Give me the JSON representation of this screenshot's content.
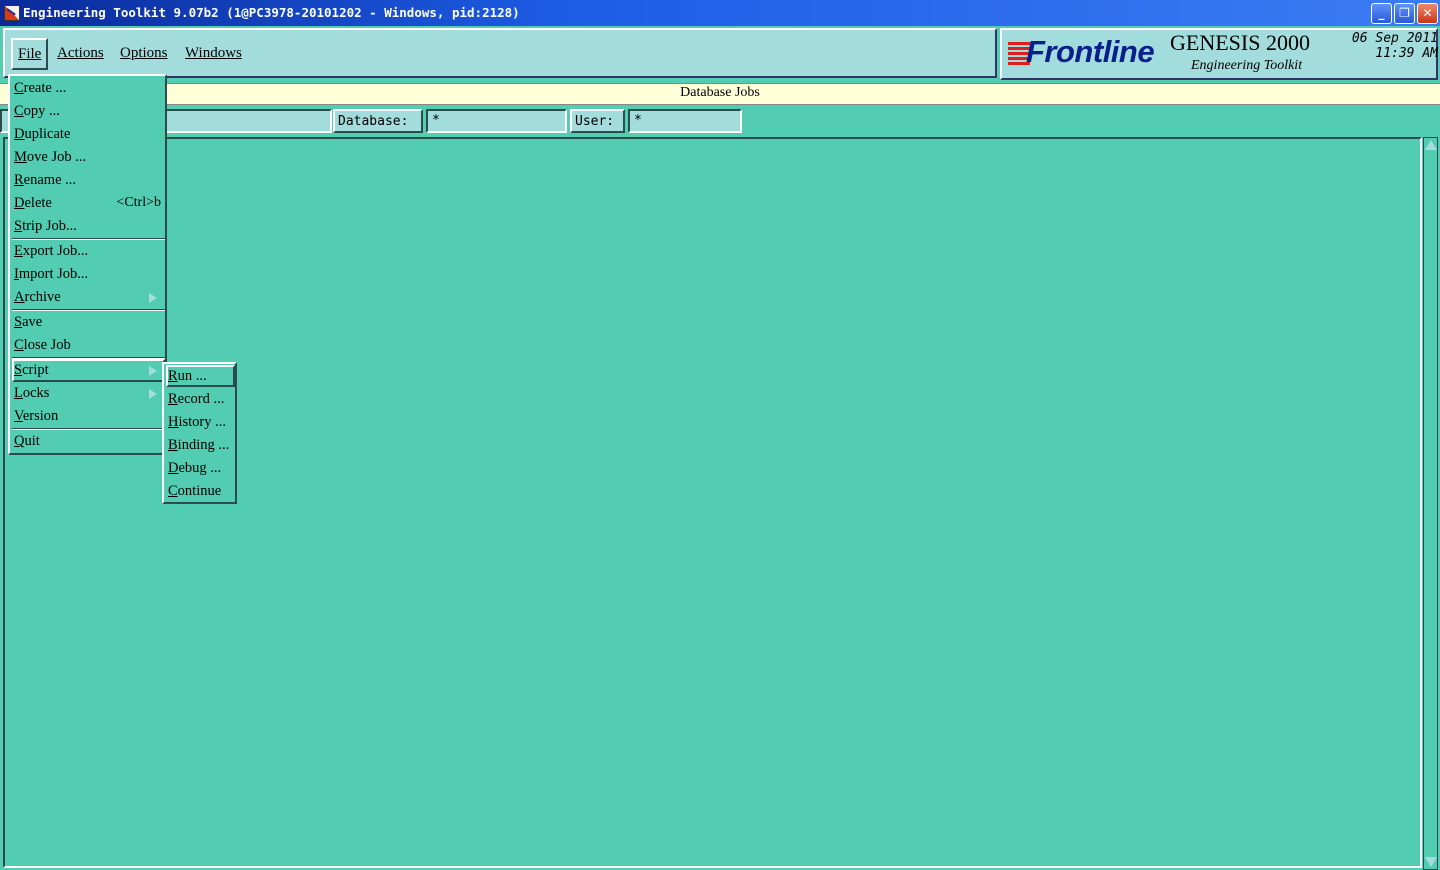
{
  "window": {
    "title": "Engineering Toolkit 9.07b2 (1@PC3978-20101202 - Windows, pid:2128)",
    "controls": {
      "minimize": "_",
      "maximize": "❐",
      "close": "✕"
    }
  },
  "menubar": {
    "items": [
      "File",
      "Actions",
      "Options",
      "Windows"
    ]
  },
  "logo": {
    "brand": "Frontline",
    "product": "GENESIS 2000",
    "subtitle": "Engineering Toolkit",
    "date": "06 Sep 2011",
    "time": "11:39 AM"
  },
  "header": {
    "title": "Database Jobs"
  },
  "filters": {
    "job_value": "",
    "database_label": "Database:",
    "database_value": "*",
    "user_label": "User:",
    "user_value": "*"
  },
  "file_menu": {
    "items": [
      {
        "label": "Create ...",
        "mnemonic": "C"
      },
      {
        "label": "Copy ...",
        "mnemonic": "C"
      },
      {
        "label": "Duplicate",
        "mnemonic": "D"
      },
      {
        "label": "Move Job ...",
        "mnemonic": "M"
      },
      {
        "label": "Rename ...",
        "mnemonic": "R"
      },
      {
        "label": "Delete",
        "mnemonic": "D",
        "shortcut": "<Ctrl>b"
      },
      {
        "label": "Strip Job...",
        "mnemonic": "S"
      },
      {
        "label": "Export Job...",
        "mnemonic": "E"
      },
      {
        "label": "Import Job...",
        "mnemonic": "I"
      },
      {
        "label": "Archive",
        "mnemonic": "A",
        "submenu": true
      },
      {
        "label": "Save",
        "mnemonic": "S"
      },
      {
        "label": "Close Job",
        "mnemonic": "C"
      },
      {
        "label": "Script",
        "mnemonic": "S",
        "submenu": true
      },
      {
        "label": "Locks",
        "mnemonic": "L",
        "submenu": true
      },
      {
        "label": "Version",
        "mnemonic": "V"
      },
      {
        "label": "Quit",
        "mnemonic": "Q"
      }
    ]
  },
  "script_menu": {
    "items": [
      {
        "label": "Run ...",
        "mnemonic": "R"
      },
      {
        "label": "Record ...",
        "mnemonic": "R"
      },
      {
        "label": "History ...",
        "mnemonic": "H"
      },
      {
        "label": "Binding ...",
        "mnemonic": "B"
      },
      {
        "label": "Debug ...",
        "mnemonic": "D"
      },
      {
        "label": "Continue",
        "mnemonic": "C"
      }
    ]
  },
  "colors": {
    "background": "#52cdb1",
    "panel": "#a2dcdc",
    "header_band": "#ffffd8",
    "title_bar": "#1d5de6",
    "logo_brand": "#0b1f8c",
    "logo_stripes": "#e21d1d"
  }
}
